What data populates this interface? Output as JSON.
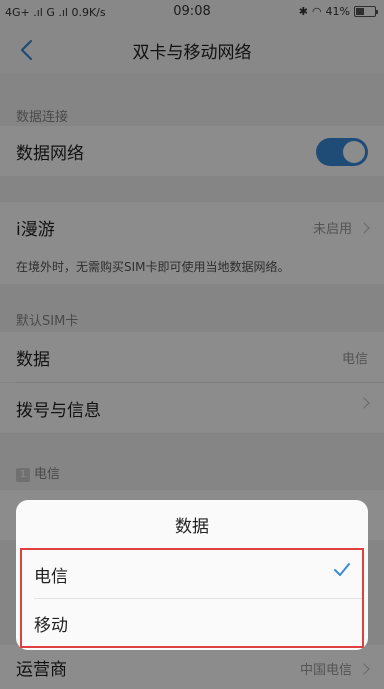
{
  "status_bar": {
    "left": "4G+ .ıl G .ıl 0.9K/s",
    "time": "09:08",
    "battery": "41%"
  },
  "nav": {
    "title": "双卡与移动网络"
  },
  "data_connection": {
    "section": "数据连接",
    "label": "数据网络",
    "enabled": true
  },
  "roaming": {
    "label": "i漫游",
    "value": "未启用",
    "hint": "在境外时，无需购买SIM卡即可使用当地数据网络。"
  },
  "default_sim": {
    "section": "默认SIM卡",
    "data_label": "数据",
    "data_value": "电信",
    "dial_label": "拨号与信息"
  },
  "sim1": {
    "badge": "1",
    "section": "电信",
    "carrier_label": "运营商",
    "carrier_value": "中国电信"
  },
  "dialog": {
    "title": "数据",
    "options": [
      {
        "label": "电信",
        "selected": true
      },
      {
        "label": "移动",
        "selected": false
      }
    ]
  },
  "colors": {
    "accent": "#3a8bd9",
    "highlight_border": "#e04040"
  }
}
